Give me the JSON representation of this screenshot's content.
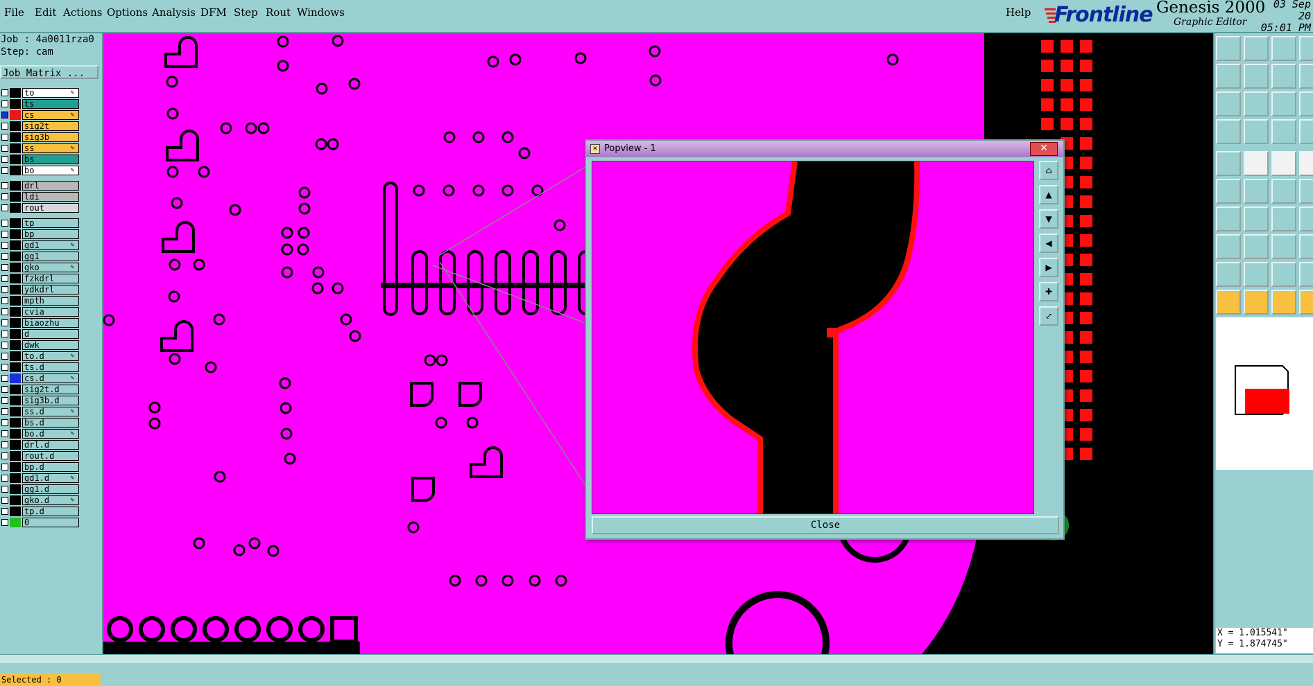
{
  "menu": {
    "file": "File",
    "edit": "Edit",
    "actions": "Actions",
    "options": "Options",
    "analysis": "Analysis",
    "dfm": "DFM",
    "step": "Step",
    "rout": "Rout",
    "windows": "Windows",
    "help": "Help"
  },
  "brand": {
    "logo": "Frontline",
    "product": "Genesis 2000",
    "subtitle": "Graphic Editor",
    "date": "03 Sep 20",
    "time": "05:01 PM"
  },
  "job": {
    "job_line": "Job : 4a0011rza0",
    "step_line": "Step: cam",
    "matrix_button": "Job Matrix ..."
  },
  "layer_groups": [
    [
      {
        "name": "to",
        "swatch": "#000000",
        "bg": "#ffffff",
        "marker": "✎"
      },
      {
        "name": "ts",
        "swatch": "#000000",
        "bg": "#20a090",
        "marker": ""
      },
      {
        "name": "cs",
        "swatch": "#e81818",
        "bg": "#f8c040",
        "marker": "✎",
        "checked": true
      },
      {
        "name": "sig2t",
        "swatch": "#000000",
        "bg": "#f8c040",
        "marker": ""
      },
      {
        "name": "sig3b",
        "swatch": "#000000",
        "bg": "#f8c040",
        "marker": ""
      },
      {
        "name": "ss",
        "swatch": "#000000",
        "bg": "#f8c040",
        "marker": "✎"
      },
      {
        "name": "bs",
        "swatch": "#000000",
        "bg": "#20a090",
        "marker": ""
      },
      {
        "name": "bo",
        "swatch": "#000000",
        "bg": "#ffffff",
        "marker": "✎"
      }
    ],
    [
      {
        "name": "drl",
        "swatch": "#000000",
        "bg": "#b8b8b8",
        "marker": ""
      },
      {
        "name": "ldi",
        "swatch": "#000000",
        "bg": "#b8b8b8",
        "marker": ""
      },
      {
        "name": "rout",
        "swatch": "#000000",
        "bg": "#d8d8d8",
        "marker": ""
      }
    ],
    [
      {
        "name": "tp",
        "swatch": "#000000",
        "bg": "#9ad0d0",
        "marker": ""
      },
      {
        "name": "bp",
        "swatch": "#000000",
        "bg": "#9ad0d0",
        "marker": ""
      },
      {
        "name": "gd1",
        "swatch": "#000000",
        "bg": "#9ad0d0",
        "marker": "✎"
      },
      {
        "name": "gg1",
        "swatch": "#000000",
        "bg": "#9ad0d0",
        "marker": ""
      },
      {
        "name": "gko",
        "swatch": "#000000",
        "bg": "#9ad0d0",
        "marker": "✎"
      },
      {
        "name": "fzkdrl",
        "swatch": "#000000",
        "bg": "#9ad0d0",
        "marker": ""
      },
      {
        "name": "ydkdrl",
        "swatch": "#000000",
        "bg": "#9ad0d0",
        "marker": ""
      },
      {
        "name": "mpth",
        "swatch": "#000000",
        "bg": "#9ad0d0",
        "marker": ""
      },
      {
        "name": "cvia",
        "swatch": "#000000",
        "bg": "#9ad0d0",
        "marker": ""
      },
      {
        "name": "biaozhu",
        "swatch": "#000000",
        "bg": "#9ad0d0",
        "marker": ""
      },
      {
        "name": "d",
        "swatch": "#000000",
        "bg": "#9ad0d0",
        "marker": ""
      },
      {
        "name": "dwk",
        "swatch": "#000000",
        "bg": "#9ad0d0",
        "marker": ""
      },
      {
        "name": "to.d",
        "swatch": "#000000",
        "bg": "#9ad0d0",
        "marker": "✎"
      },
      {
        "name": "ts.d",
        "swatch": "#000000",
        "bg": "#9ad0d0",
        "marker": ""
      },
      {
        "name": "cs.d",
        "swatch": "#1830d8",
        "bg": "#9ad0d0",
        "marker": "✎"
      },
      {
        "name": "sig2t.d",
        "swatch": "#000000",
        "bg": "#9ad0d0",
        "marker": ""
      },
      {
        "name": "sig3b.d",
        "swatch": "#000000",
        "bg": "#9ad0d0",
        "marker": ""
      },
      {
        "name": "ss.d",
        "swatch": "#000000",
        "bg": "#9ad0d0",
        "marker": "✎"
      },
      {
        "name": "bs.d",
        "swatch": "#000000",
        "bg": "#9ad0d0",
        "marker": ""
      },
      {
        "name": "bo.d",
        "swatch": "#000000",
        "bg": "#9ad0d0",
        "marker": "✎"
      },
      {
        "name": "drl.d",
        "swatch": "#000000",
        "bg": "#9ad0d0",
        "marker": ""
      },
      {
        "name": "rout.d",
        "swatch": "#000000",
        "bg": "#9ad0d0",
        "marker": ""
      },
      {
        "name": "bp.d",
        "swatch": "#000000",
        "bg": "#9ad0d0",
        "marker": ""
      },
      {
        "name": "gd1.d",
        "swatch": "#000000",
        "bg": "#9ad0d0",
        "marker": "✎"
      },
      {
        "name": "gg1.d",
        "swatch": "#000000",
        "bg": "#9ad0d0",
        "marker": ""
      },
      {
        "name": "gko.d",
        "swatch": "#000000",
        "bg": "#9ad0d0",
        "marker": "✎"
      },
      {
        "name": "tp.d",
        "swatch": "#000000",
        "bg": "#9ad0d0",
        "marker": ""
      },
      {
        "name": "0",
        "swatch": "#20c020",
        "bg": "#9ad0d0",
        "marker": ""
      }
    ]
  ],
  "status": {
    "selected": "Selected : 0",
    "x": "X = 1.015541\"",
    "y": "Y = 1.874745\""
  },
  "popview": {
    "title": "Popview - 1",
    "close_x": "✕",
    "close_button": "Close"
  },
  "colors": {
    "background_panel": "#9ad0d0",
    "board_layer": "#ff00ff",
    "copper": "#000000",
    "highlight": "#ff0000",
    "selected_bar": "#f8c040"
  }
}
